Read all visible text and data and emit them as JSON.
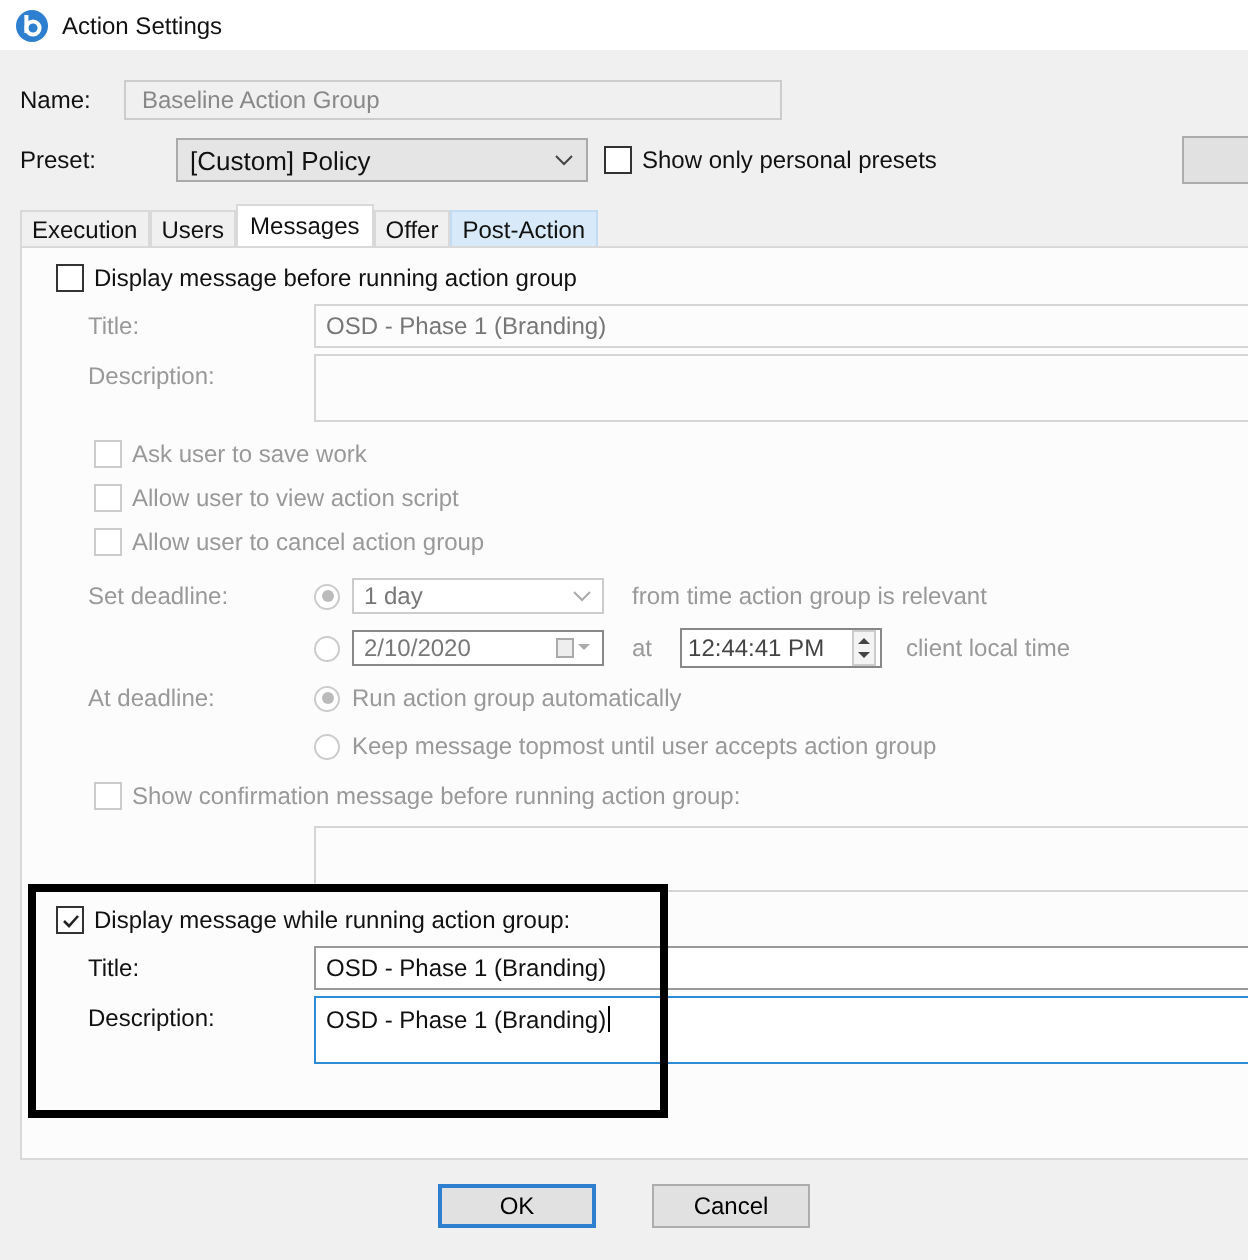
{
  "window": {
    "title": "Action Settings"
  },
  "name": {
    "label": "Name:",
    "value": "Baseline Action Group",
    "disabled": true
  },
  "preset": {
    "label": "Preset:",
    "value": "[Custom] Policy"
  },
  "personal_presets": {
    "label": "Show only personal presets",
    "checked": false
  },
  "tabs": [
    {
      "label": "Execution",
      "selected": false,
      "hovered": false
    },
    {
      "label": "Users",
      "selected": false,
      "hovered": false
    },
    {
      "label": "Messages",
      "selected": true,
      "hovered": false
    },
    {
      "label": "Offer",
      "selected": false,
      "hovered": false
    },
    {
      "label": "Post-Action",
      "selected": false,
      "hovered": true
    }
  ],
  "before_message": {
    "label": "Display message before running action group",
    "checked": false,
    "title_label": "Title:",
    "title_value": "OSD - Phase 1 (Branding)",
    "description_label": "Description:"
  },
  "options": [
    {
      "label": "Ask user to save work",
      "checked": false
    },
    {
      "label": "Allow user to view action script",
      "checked": false
    },
    {
      "label": "Allow user to cancel action group",
      "checked": false
    }
  ],
  "deadline": {
    "label": "Set deadline:",
    "options": [
      {
        "kind": "relative",
        "selected": true,
        "value": "1 day",
        "suffix": "from time action group is relevant"
      },
      {
        "kind": "absolute",
        "selected": false,
        "date": "2/10/2020",
        "at": "at",
        "time": "12:44:41 PM",
        "suffix": "client local time"
      }
    ]
  },
  "at_deadline": {
    "label": "At deadline:",
    "options": [
      {
        "label": "Run action group automatically",
        "selected": true
      },
      {
        "label": "Keep message topmost until user accepts action group",
        "selected": false
      }
    ]
  },
  "confirmation": {
    "label": "Show confirmation message before running action group:",
    "checked": false
  },
  "while_message": {
    "label": "Display message while running action group:",
    "checked": true,
    "title_label": "Title:",
    "title_value": "OSD - Phase 1 (Branding)",
    "description_label": "Description:",
    "description_value": "OSD - Phase 1 (Branding)",
    "description_focused": true
  },
  "buttons": [
    {
      "label": "OK",
      "default": true
    },
    {
      "label": "Cancel",
      "default": false
    }
  ]
}
